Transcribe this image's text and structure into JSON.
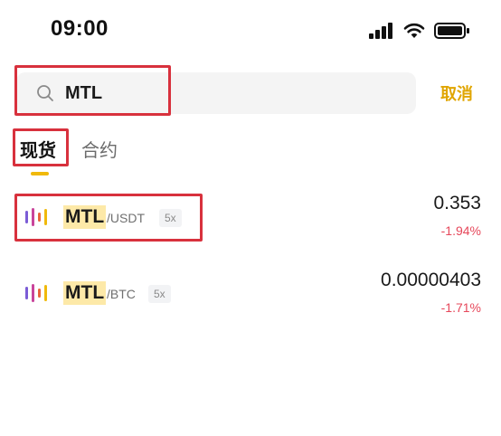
{
  "status_bar": {
    "time": "09:00",
    "icons": [
      "signal-icon",
      "wifi-icon",
      "battery-icon"
    ]
  },
  "search": {
    "value": "MTL",
    "cancel_label": "取消"
  },
  "tabs": [
    {
      "label": "现货",
      "active": true
    },
    {
      "label": "合约",
      "active": false
    }
  ],
  "results": [
    {
      "base": "MTL",
      "quote": "/USDT",
      "leverage": "5x",
      "price": "0.353",
      "change": "-1.94%"
    },
    {
      "base": "MTL",
      "quote": "/BTC",
      "leverage": "5x",
      "price": "0.00000403",
      "change": "-1.71%"
    }
  ],
  "colors": {
    "accent": "#f0b90b",
    "cancel": "#e0a500",
    "negative": "#e6485b",
    "highlight_box": "#d8313d",
    "match_highlight": "#fde9a8"
  }
}
